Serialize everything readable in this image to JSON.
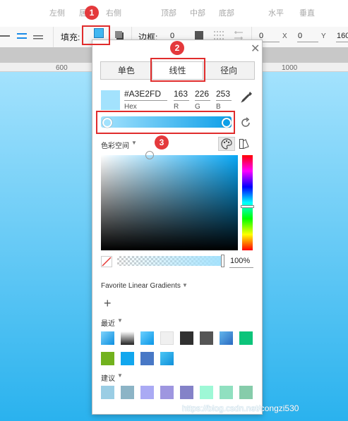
{
  "topbar": {
    "labels": [
      "左侧",
      "居",
      "右侧",
      "顶部",
      "中部",
      "底部",
      "水平",
      "垂直"
    ]
  },
  "toolbar": {
    "fill_label": "填充:",
    "border_label": "边框:",
    "border_width": "0",
    "x_value": "0",
    "x_suffix": "X",
    "y_value": "0",
    "y_suffix": "Y",
    "w_value": "160"
  },
  "ruler": {
    "ticks": [
      "600",
      "1000"
    ]
  },
  "annotations": {
    "badge1": "1",
    "badge2": "2",
    "badge3": "3"
  },
  "picker": {
    "tabs": [
      {
        "label": "单色",
        "active": false
      },
      {
        "label": "线性",
        "active": true
      },
      {
        "label": "径向",
        "active": false
      }
    ],
    "hex": "#A3E2FD",
    "hex_label": "Hex",
    "r": "163",
    "r_label": "R",
    "g": "226",
    "g_label": "G",
    "b": "253",
    "b_label": "B",
    "color_space_label": "色彩空间",
    "opacity": "100%",
    "favorites_label": "Favorite Linear Gradients",
    "add_label": "+",
    "recent_label": "最近",
    "suggest_label": "建议",
    "recent_swatches": [
      "linear-gradient(135deg,#7fd3fb,#0d8fe0)",
      "linear-gradient(#ffffff,#222222)",
      "linear-gradient(135deg,#6ad0ff,#0a96e6)",
      "#f0f0f0",
      "#303030",
      "#555555",
      "linear-gradient(135deg,#62b6ec,#2a69c0)",
      "#0cc47a",
      "#72b21e",
      "#12a7ee",
      "#4878c6",
      "linear-gradient(135deg,#4bc6f5,#0f8fd9)"
    ],
    "suggest_swatches": [
      "#9acde4",
      "#8cb4c6",
      "#aaaaf4",
      "#9e96e0",
      "#8482c8",
      "#9ef8d6",
      "#90e0c0",
      "#86ccaa"
    ]
  },
  "watermark": "https://blog.csdn.net/congzi530",
  "colors": {
    "accent": "#e02c2c",
    "fill_color": "#a3e2fd"
  }
}
